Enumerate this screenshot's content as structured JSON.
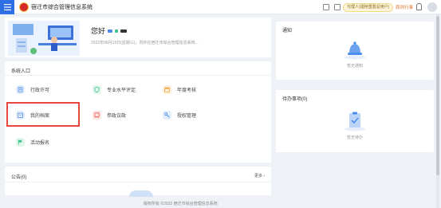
{
  "header": {
    "title": "宿迁市综合管理信息系统",
    "pending_badge": "代理人(福特重置总用户)",
    "pending_link": "原则行事"
  },
  "welcome": {
    "greeting": "您好",
    "subtitle": "2022年06月15日(星期三)，祝你在宿迁市综合管理信息系统..."
  },
  "system_entry": {
    "title": "系统入口",
    "items": [
      {
        "label": "行政许可",
        "icon": "document-icon",
        "color": "#4a8cf0"
      },
      {
        "label": "专业水平评定",
        "icon": "shield-icon",
        "color": "#3cc28a"
      },
      {
        "label": "年度考核",
        "icon": "calendar-icon",
        "color": "#f0a43a"
      },
      {
        "label": "我的档案",
        "icon": "archive-icon",
        "color": "#4a8cf0"
      },
      {
        "label": "参政议政",
        "icon": "bus-icon",
        "color": "#e8564a"
      },
      {
        "label": "授权管理",
        "icon": "key-icon",
        "color": "#4a8cf0"
      },
      {
        "label": "活动报名",
        "icon": "flag-icon",
        "color": "#3cc28a"
      }
    ]
  },
  "announcement": {
    "title": "公告(0)",
    "more": "更多 ›"
  },
  "notify": {
    "title": "通知",
    "empty": "暂无通知"
  },
  "todo": {
    "title": "待办事项(0)",
    "empty": "暂无待办"
  },
  "footer": {
    "text": "版权所有 ©2022 宿迁市综合管理信息系统"
  }
}
